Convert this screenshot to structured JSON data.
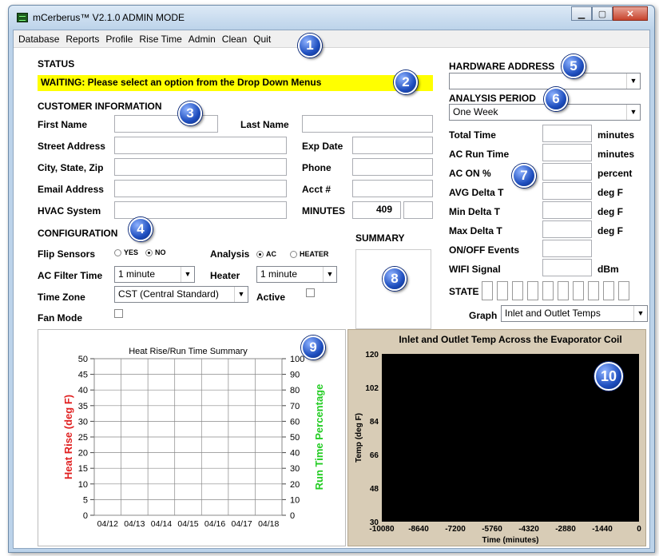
{
  "window": {
    "title": "mCerberus™ V2.1.0 ADMIN MODE"
  },
  "menu": [
    "Database",
    "Reports",
    "Profile",
    "Rise Time",
    "Admin",
    "Clean",
    "Quit"
  ],
  "callouts": [
    "1",
    "2",
    "3",
    "4",
    "5",
    "6",
    "7",
    "8",
    "9",
    "10"
  ],
  "status": {
    "header": "STATUS",
    "message": "WAITING: Please select an option from the Drop Down Menus"
  },
  "customer": {
    "header": "CUSTOMER INFORMATION",
    "first_name_label": "First Name",
    "last_name_label": "Last Name",
    "street_label": "Street Address",
    "exp_label": "Exp Date",
    "city_label": "City, State, Zip",
    "phone_label": "Phone",
    "email_label": "Email Address",
    "acct_label": "Acct #",
    "hvac_label": "HVAC System",
    "minutes_label": "MINUTES",
    "minutes_value": "409"
  },
  "config": {
    "header": "CONFIGURATION",
    "flip_label": "Flip Sensors",
    "yes": "YES",
    "no": "NO",
    "analysis_label": "Analysis",
    "ac": "AC",
    "heater": "HEATER",
    "filter_label": "AC Filter Time",
    "filter_value": "1 minute",
    "heater_label": "Heater",
    "heater_value": "1 minute",
    "tz_label": "Time Zone",
    "tz_value": "CST (Central Standard)",
    "active_label": "Active",
    "fan_label": "Fan Mode"
  },
  "summary": {
    "header": "SUMMARY"
  },
  "hardware": {
    "header": "HARDWARE ADDRESS",
    "value": ""
  },
  "analysis_period": {
    "header": "ANALYSIS PERIOD",
    "value": "One Week"
  },
  "metrics": [
    {
      "label": "Total Time",
      "unit": "minutes"
    },
    {
      "label": "AC Run Time",
      "unit": "minutes"
    },
    {
      "label": "AC ON %",
      "unit": "percent"
    },
    {
      "label": "AVG Delta T",
      "unit": "deg F"
    },
    {
      "label": "Min Delta T",
      "unit": "deg F"
    },
    {
      "label": "Max Delta T",
      "unit": "deg F"
    },
    {
      "label": "ON/OFF Events",
      "unit": ""
    },
    {
      "label": "WIFI Signal",
      "unit": "dBm"
    }
  ],
  "state": {
    "label": "STATE"
  },
  "graph": {
    "label": "Graph",
    "value": "Inlet and Outlet Temps"
  },
  "chart_data": [
    {
      "type": "line",
      "title": "Heat Rise/Run Time Summary",
      "ylabel": "Heat Rise (deg F)",
      "ylabel_color": "#e02020",
      "y2label": "Run Time Percentage",
      "y2label_color": "#22cc22",
      "categories": [
        "04/12",
        "04/13",
        "04/14",
        "04/15",
        "04/16",
        "04/17",
        "04/18"
      ],
      "ylim": [
        0,
        50
      ],
      "yticks": [
        0,
        5,
        10,
        15,
        20,
        25,
        30,
        35,
        40,
        45,
        50
      ],
      "y2lim": [
        0,
        100
      ],
      "y2ticks": [
        0,
        10,
        20,
        30,
        40,
        50,
        60,
        70,
        80,
        90,
        100
      ],
      "grid": true,
      "series": []
    },
    {
      "type": "line",
      "title": "Inlet and Outlet Temp Across the Evaporator Coil",
      "xlabel": "Time (minutes)",
      "ylabel": "Temp (deg F)",
      "xlim": [
        -10080,
        0
      ],
      "xticks": [
        -10080,
        -8640,
        -7200,
        -5760,
        -4320,
        -2880,
        -1440,
        0
      ],
      "ylim": [
        30,
        120
      ],
      "yticks": [
        30,
        48,
        66,
        84,
        102,
        120
      ],
      "plot_bg": "#000000",
      "series": []
    }
  ]
}
